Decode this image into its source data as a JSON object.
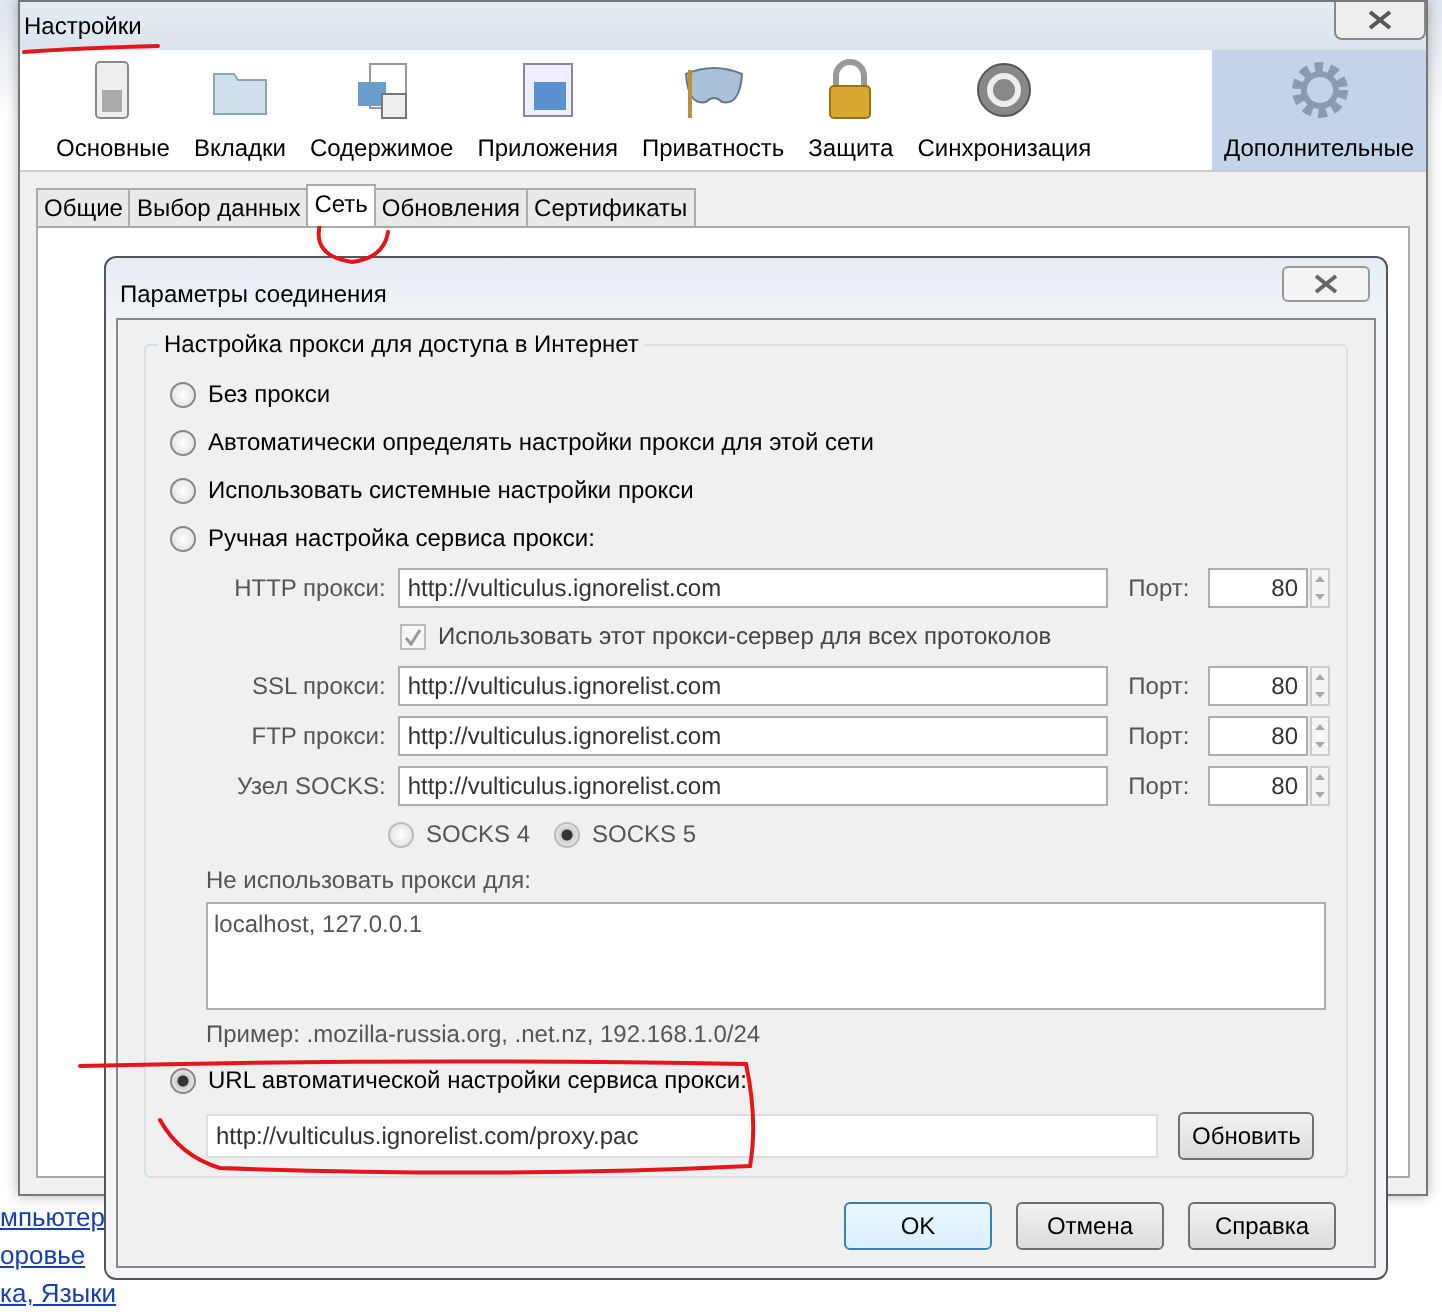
{
  "window": {
    "title": "Настройки"
  },
  "toolbar": [
    {
      "label": "Основные",
      "selected": false
    },
    {
      "label": "Вкладки",
      "selected": false
    },
    {
      "label": "Содержимое",
      "selected": false
    },
    {
      "label": "Приложения",
      "selected": false
    },
    {
      "label": "Приватность",
      "selected": false
    },
    {
      "label": "Защита",
      "selected": false
    },
    {
      "label": "Синхронизация",
      "selected": false
    },
    {
      "label": "Дополнительные",
      "selected": true
    }
  ],
  "tabs": [
    {
      "label": "Общие",
      "selected": false
    },
    {
      "label": "Выбор данных",
      "selected": false
    },
    {
      "label": "Сеть",
      "selected": true
    },
    {
      "label": "Обновления",
      "selected": false
    },
    {
      "label": "Сертификаты",
      "selected": false
    }
  ],
  "background_links": [
    "мпьютер",
    "оровье",
    "ка, Языки"
  ],
  "dialog": {
    "title": "Параметры соединения",
    "group_title": "Настройка прокси для доступа в Интернет",
    "options": [
      {
        "label": "Без прокси",
        "selected": false
      },
      {
        "label": "Автоматически определять настройки прокси для этой сети",
        "selected": false
      },
      {
        "label": "Использовать системные настройки прокси",
        "selected": false
      },
      {
        "label": "Ручная настройка сервиса прокси:",
        "selected": false
      }
    ],
    "proxies": [
      {
        "label": "HTTP прокси:",
        "value": "http://vulticulus.ignorelist.com",
        "port_label": "Порт:",
        "port": "80"
      },
      {
        "label": "SSL прокси:",
        "value": "http://vulticulus.ignorelist.com",
        "port_label": "Порт:",
        "port": "80"
      },
      {
        "label": "FTP прокси:",
        "value": "http://vulticulus.ignorelist.com",
        "port_label": "Порт:",
        "port": "80"
      },
      {
        "label": "Узел SOCKS:",
        "value": "http://vulticulus.ignorelist.com",
        "port_label": "Порт:",
        "port": "80"
      }
    ],
    "share_all": {
      "label": "Использовать этот прокси-сервер для всех протоколов",
      "checked": true
    },
    "socks_versions": [
      {
        "label": "SOCKS 4",
        "selected": false
      },
      {
        "label": "SOCKS 5",
        "selected": true
      }
    ],
    "no_proxy": {
      "label": "Не использовать прокси для:",
      "value": "localhost, 127.0.0.1"
    },
    "example": "Пример: .mozilla-russia.org, .net.nz, 192.168.1.0/24",
    "auto_url": {
      "label": "URL автоматической настройки сервиса прокси:",
      "selected": true,
      "value": "http://vulticulus.ignorelist.com/proxy.pac",
      "button": "Обновить"
    },
    "buttons": [
      "OK",
      "Отмена",
      "Справка"
    ]
  }
}
